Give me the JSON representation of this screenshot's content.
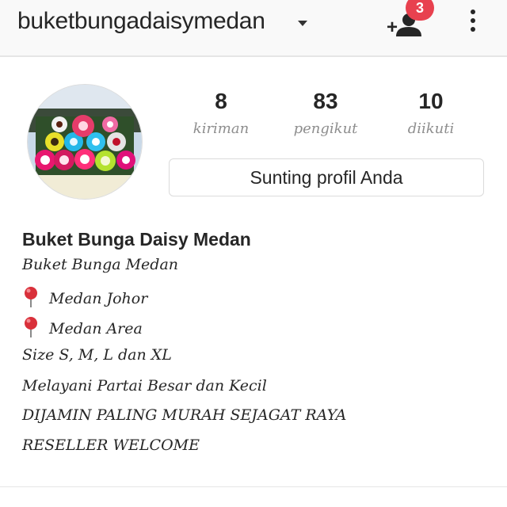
{
  "header": {
    "username": "buketbungadaisymedan",
    "notification_count": "3"
  },
  "stats": [
    {
      "value": "8",
      "label": "kiriman"
    },
    {
      "value": "83",
      "label": "pengikut"
    },
    {
      "value": "10",
      "label": "diikuti"
    }
  ],
  "edit_profile_label": "Sunting profil Anda",
  "bio": {
    "name": "Buket Bunga Daisy Medan",
    "lines": [
      "Buket Bunga Medan",
      "Medan Johor",
      "Medan Area",
      "Size S, M, L dan XL",
      "Melayani Partai Besar dan Kecil",
      "DIJAMIN PALING MURAH SEJAGAT RAYA",
      "RESELLER WELCOME"
    ]
  },
  "icons": {
    "dropdown": "chevron-down-icon",
    "add_user": "add-user-icon",
    "more": "more-vertical-icon",
    "pin": "pushpin-icon"
  },
  "colors": {
    "badge": "#e8414f",
    "pin": "#d9303a"
  }
}
